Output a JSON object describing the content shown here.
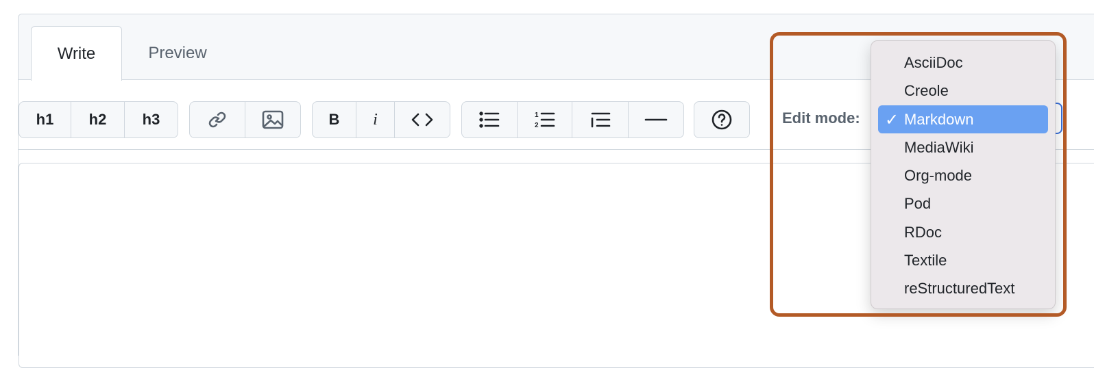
{
  "tabs": {
    "write": "Write",
    "preview": "Preview"
  },
  "toolbar": {
    "headings": [
      "h1",
      "h2",
      "h3"
    ],
    "bold": "B",
    "italic": "i",
    "icons": [
      "link-icon",
      "image-icon",
      "code-icon",
      "unordered-list-icon",
      "ordered-list-icon",
      "task-list-icon",
      "horizontal-rule-icon",
      "help-icon"
    ]
  },
  "edit_mode": {
    "label": "Edit mode:",
    "check": "✓",
    "options": [
      "AsciiDoc",
      "Creole",
      "Markdown",
      "MediaWiki",
      "Org-mode",
      "Pod",
      "RDoc",
      "Textile",
      "reStructuredText"
    ],
    "selected": "Markdown"
  },
  "colors": {
    "highlight": "#b35a26",
    "selected": "#6aa1f2",
    "border": "#d0d7de"
  }
}
